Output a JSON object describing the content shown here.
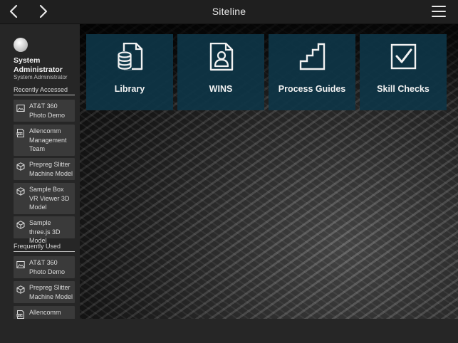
{
  "header": {
    "title": "Siteline",
    "back_icon": "chevron-left-icon",
    "forward_icon": "chevron-right-icon",
    "menu_icon": "hamburger-menu-icon"
  },
  "user": {
    "name": "System Administrator",
    "role": "System Administrator"
  },
  "recent": {
    "header": "Recently Accessed",
    "items": [
      {
        "label": "AT&T 360 Photo Demo",
        "icon": "image-icon"
      },
      {
        "label": "Allencomm Management Team",
        "icon": "pdf-icon"
      },
      {
        "label": "Prepreg Slitter Machine Model",
        "icon": "3d-cube-icon"
      },
      {
        "label": "Sample Box VR Viewer 3D Model",
        "icon": "3d-cube-icon"
      },
      {
        "label": "Sample three.js 3D Model",
        "icon": "3d-cube-icon"
      }
    ]
  },
  "frequent": {
    "header": "Frequently Used",
    "items": [
      {
        "label": "AT&T 360 Photo Demo",
        "icon": "image-icon"
      },
      {
        "label": "Prepreg Slitter Machine Model",
        "icon": "3d-cube-icon"
      },
      {
        "label": "Allencomm Management Team",
        "icon": "pdf-icon"
      }
    ]
  },
  "tiles": [
    {
      "label": "Library",
      "icon": "library-database-icon"
    },
    {
      "label": "WINS",
      "icon": "person-document-icon"
    },
    {
      "label": "Process Guides",
      "icon": "stairs-icon"
    },
    {
      "label": "Skill Checks",
      "icon": "checkbox-icon"
    }
  ],
  "colors": {
    "tile_background": "#0e3546",
    "sidebar_background": "#262626",
    "topbar_background": "#1f1f1f"
  }
}
